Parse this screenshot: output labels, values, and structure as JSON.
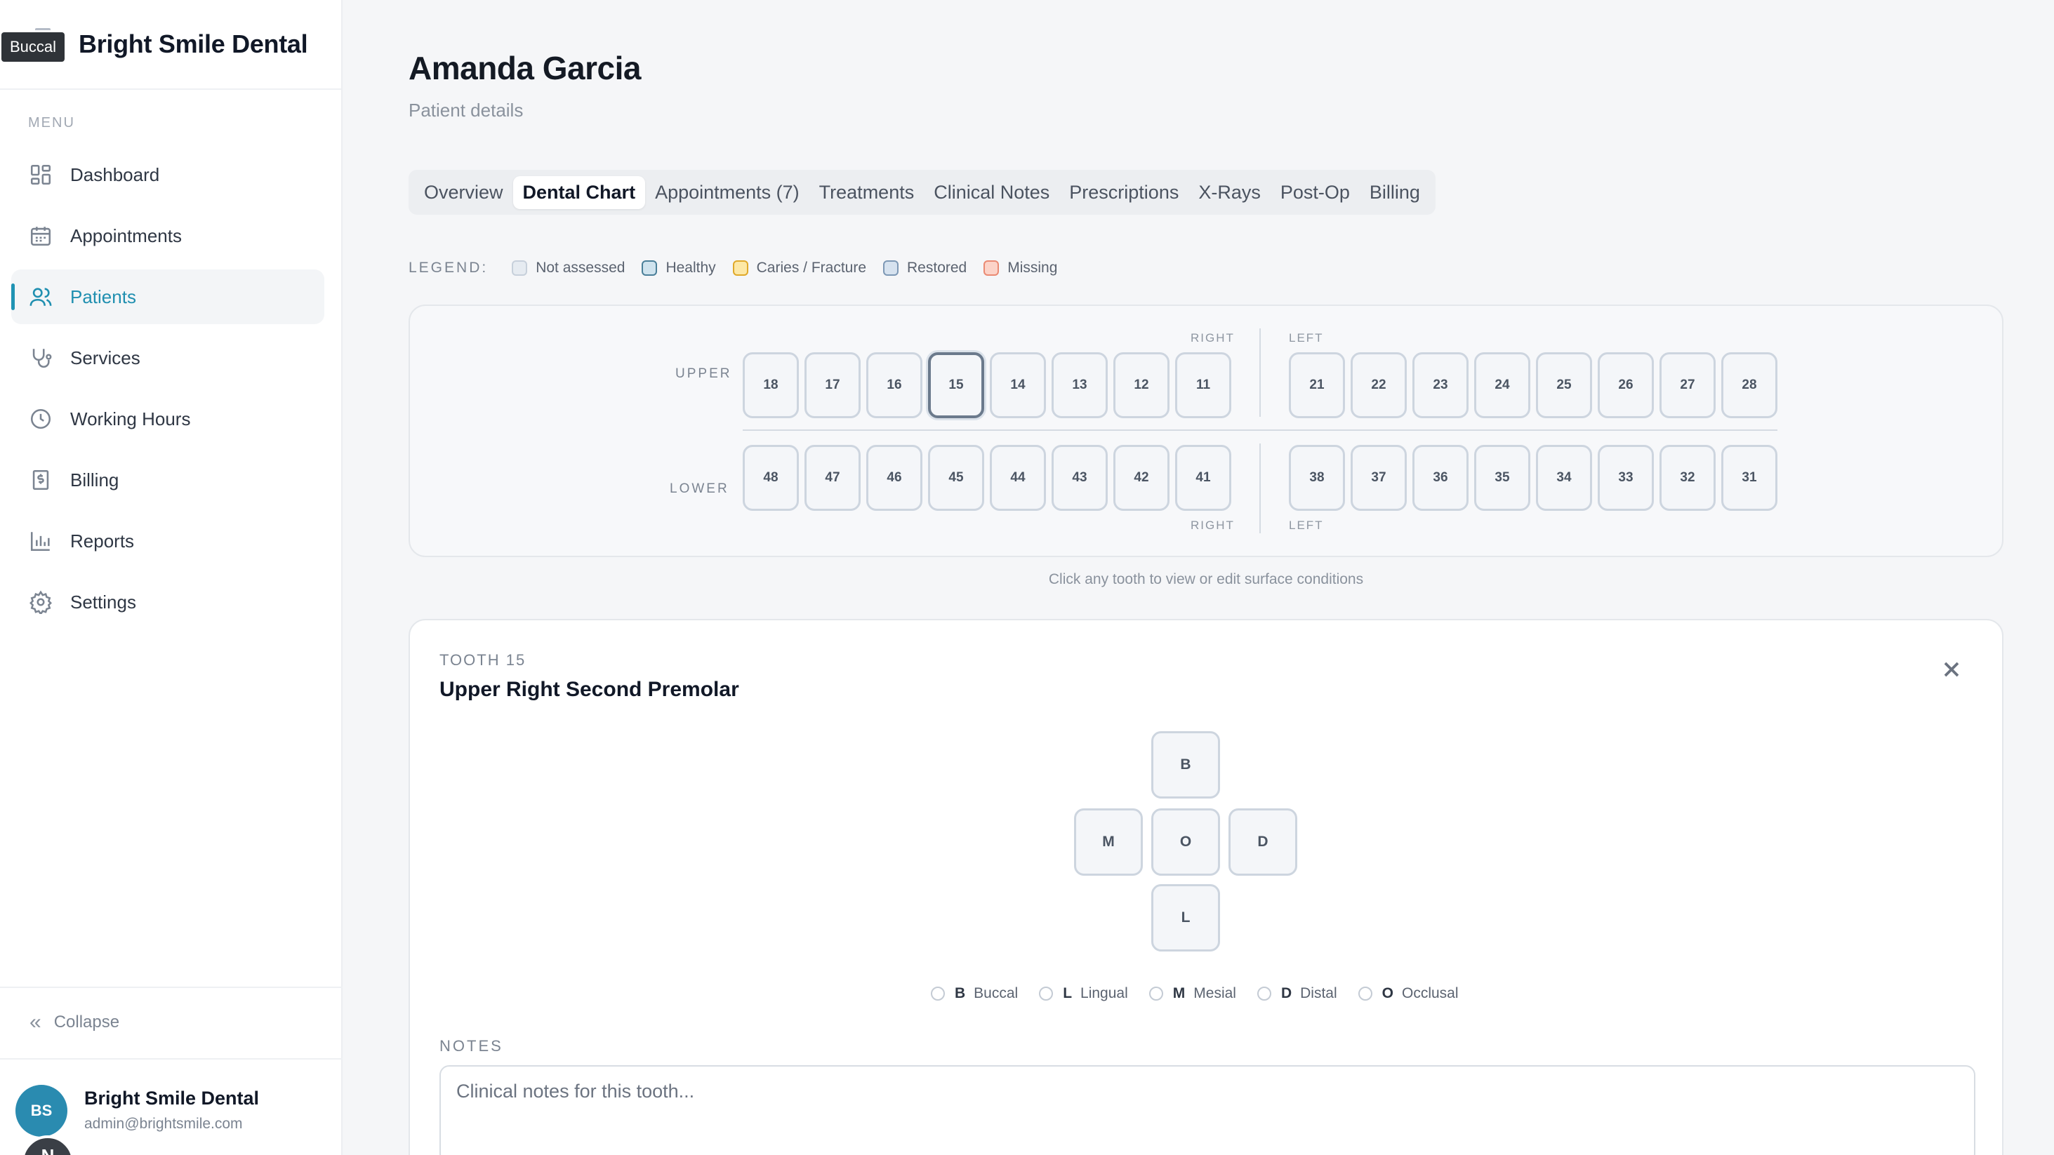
{
  "brand": {
    "name": "Bright Smile Dental",
    "tooltip": "Buccal"
  },
  "sidebar": {
    "menu_label": "MENU",
    "items": [
      {
        "label": "Dashboard",
        "icon": "dashboard-icon"
      },
      {
        "label": "Appointments",
        "icon": "calendar-icon"
      },
      {
        "label": "Patients",
        "icon": "users-icon",
        "active": true
      },
      {
        "label": "Services",
        "icon": "stethoscope-icon"
      },
      {
        "label": "Working Hours",
        "icon": "clock-icon"
      },
      {
        "label": "Billing",
        "icon": "invoice-icon"
      },
      {
        "label": "Reports",
        "icon": "bar-chart-icon"
      },
      {
        "label": "Settings",
        "icon": "gear-icon"
      }
    ],
    "collapse_label": "Collapse",
    "user": {
      "initials": "BS",
      "name": "Bright Smile Dental",
      "email": "admin@brightsmile.com",
      "second_initial": "N"
    }
  },
  "patient": {
    "name": "Amanda Garcia",
    "subtitle": "Patient details"
  },
  "tabs": [
    {
      "label": "Overview"
    },
    {
      "label": "Dental Chart",
      "active": true
    },
    {
      "label": "Appointments (7)"
    },
    {
      "label": "Treatments"
    },
    {
      "label": "Clinical Notes"
    },
    {
      "label": "Prescriptions"
    },
    {
      "label": "X-Rays"
    },
    {
      "label": "Post-Op"
    },
    {
      "label": "Billing"
    }
  ],
  "legend": {
    "title": "LEGEND:",
    "items": [
      {
        "label": "Not assessed",
        "fill": "#e6ebf1",
        "border": "#c7d0db"
      },
      {
        "label": "Healthy",
        "fill": "#cfe3ee",
        "border": "#4a7f99"
      },
      {
        "label": "Caries / Fracture",
        "fill": "#fde8a6",
        "border": "#e0a92a"
      },
      {
        "label": "Restored",
        "fill": "#d6e2ef",
        "border": "#7d98b5"
      },
      {
        "label": "Missing",
        "fill": "#fcd3c8",
        "border": "#ea8a73"
      }
    ]
  },
  "chart": {
    "upper_label": "UPPER",
    "lower_label": "LOWER",
    "right_label": "RIGHT",
    "left_label": "LEFT",
    "upper_right": [
      "18",
      "17",
      "16",
      "15",
      "14",
      "13",
      "12",
      "11"
    ],
    "upper_left": [
      "21",
      "22",
      "23",
      "24",
      "25",
      "26",
      "27",
      "28"
    ],
    "lower_right": [
      "48",
      "47",
      "46",
      "45",
      "44",
      "43",
      "42",
      "41"
    ],
    "lower_left": [
      "38",
      "37",
      "36",
      "35",
      "34",
      "33",
      "32",
      "31"
    ],
    "selected": "15",
    "hint": "Click any tooth to view or edit surface conditions"
  },
  "detail": {
    "kicker": "TOOTH 15",
    "title": "Upper Right Second Premolar",
    "surfaces": {
      "B": "B",
      "M": "M",
      "O": "O",
      "D": "D",
      "L": "L"
    },
    "surface_legend": [
      {
        "code": "B",
        "label": "Buccal"
      },
      {
        "code": "L",
        "label": "Lingual"
      },
      {
        "code": "M",
        "label": "Mesial"
      },
      {
        "code": "D",
        "label": "Distal"
      },
      {
        "code": "O",
        "label": "Occlusal"
      }
    ],
    "notes_label": "NOTES",
    "notes_placeholder": "Clinical notes for this tooth..."
  }
}
